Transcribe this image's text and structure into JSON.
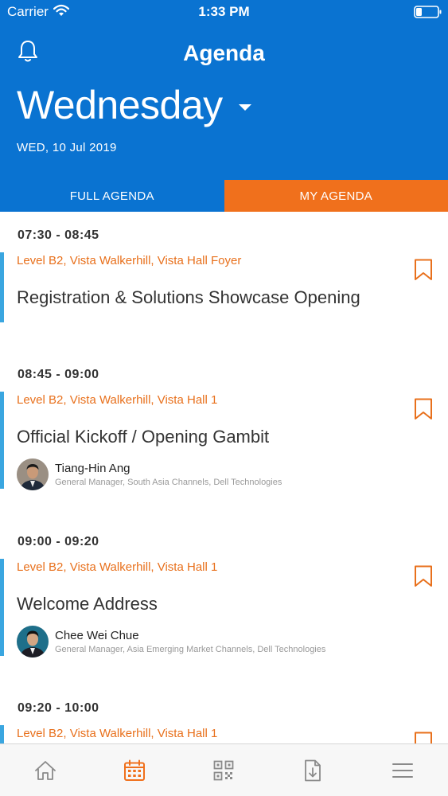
{
  "status_bar": {
    "carrier": "Carrier",
    "time": "1:33 PM",
    "icons": [
      "wifi-icon",
      "battery-icon"
    ]
  },
  "header": {
    "title": "Agenda",
    "day": "Wednesday",
    "date": "WED, 10 Jul 2019",
    "icons": [
      "bell-icon",
      "chevron-down-icon"
    ]
  },
  "tabs": [
    {
      "label": "FULL AGENDA",
      "selected": false
    },
    {
      "label": "MY AGENDA",
      "selected": true
    }
  ],
  "sessions": [
    {
      "time": "07:30 - 08:45",
      "location": "Level B2, Vista Walkerhill, Vista Hall Foyer",
      "title": "Registration & Solutions Showcase Opening",
      "speaker": null
    },
    {
      "time": "08:45 - 09:00",
      "location": "Level B2, Vista Walkerhill, Vista Hall 1",
      "title": "Official Kickoff / Opening Gambit",
      "speaker": {
        "name": "Tiang-Hin Ang",
        "role": "General Manager, South Asia Channels, Dell Technologies"
      }
    },
    {
      "time": "09:00 - 09:20",
      "location": "Level B2, Vista Walkerhill, Vista Hall 1",
      "title": "Welcome Address",
      "speaker": {
        "name": "Chee Wei Chue",
        "role": "General Manager, Asia Emerging Market Channels, Dell Technologies"
      }
    },
    {
      "time": "09:20 - 10:00",
      "location": "Level B2, Vista Walkerhill, Vista Hall 1",
      "title": "",
      "speaker": null
    }
  ],
  "tab_bar": {
    "items": [
      "home-icon",
      "calendar-icon",
      "qr-code-icon",
      "download-document-icon",
      "menu-icon"
    ],
    "active": "calendar-icon"
  },
  "colors": {
    "header_blue": "#0a73d1",
    "accent_orange": "#f0701c",
    "location_orange": "#e8701c",
    "accent_bar": "#3aa6e0"
  }
}
